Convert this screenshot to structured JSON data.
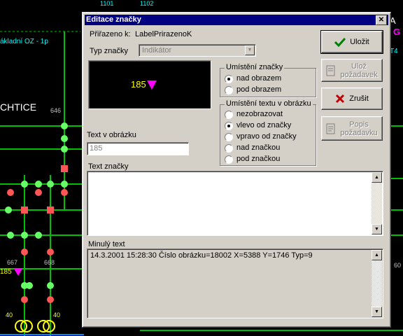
{
  "background": {
    "labels": {
      "top_1101": "1101",
      "top_1102": "1102",
      "zakladni": "ákladní OZ - 1p",
      "chtice": "CHTICE",
      "n646": "646",
      "n667": "667",
      "n668": "668",
      "n185": "185",
      "n40a": "40",
      "n40b": "40",
      "right_a": "A",
      "right_g": "G",
      "right_t4": "T4",
      "right_60": "60"
    }
  },
  "dialog": {
    "title": "Editace značky",
    "close_label": "✕",
    "assigned_label": "Přiřazeno k:",
    "assigned_value": "LabelPrirazenoK",
    "type_label": "Typ značky",
    "type_value": "Indikátor",
    "preview": {
      "text": "185",
      "marker_color": "#ff00ff"
    },
    "placement_group": {
      "title": "Umístění značky",
      "options": [
        {
          "label": "nad obrazem",
          "checked": true
        },
        {
          "label": "pod obrazem",
          "checked": false
        }
      ]
    },
    "text_placement_group": {
      "title": "Umístění textu v obrázku",
      "options": [
        {
          "label": "nezobrazovat",
          "checked": false
        },
        {
          "label": "vlevo od značky",
          "checked": true
        },
        {
          "label": "vpravo od značky",
          "checked": false
        },
        {
          "label": "nad značkou",
          "checked": false
        },
        {
          "label": "pod značkou",
          "checked": false
        }
      ]
    },
    "text_in_image_label": "Text v obrázku",
    "text_in_image_value": "185",
    "mark_text_label": "Text značky",
    "mark_text_value": "",
    "past_text_label": "Minulý text",
    "past_text_value": "14.3.2001  15:28:30  Číslo obrázku=18002 X=5388 Y=1746  Typ=9",
    "buttons": {
      "save": "Uložit",
      "save_request": "Ulož\npožadavek",
      "cancel": "Zrušit",
      "request_desc": "Popis\npožadavku"
    }
  },
  "colors": {
    "dialog_bg": "#d4d0c8",
    "titlebar": "#000080",
    "grid_green": "#00ff00",
    "node_green": "#66ff66",
    "node_red": "#ff5555",
    "marker_magenta": "#ff00ff",
    "label_cyan": "#00ffff"
  }
}
